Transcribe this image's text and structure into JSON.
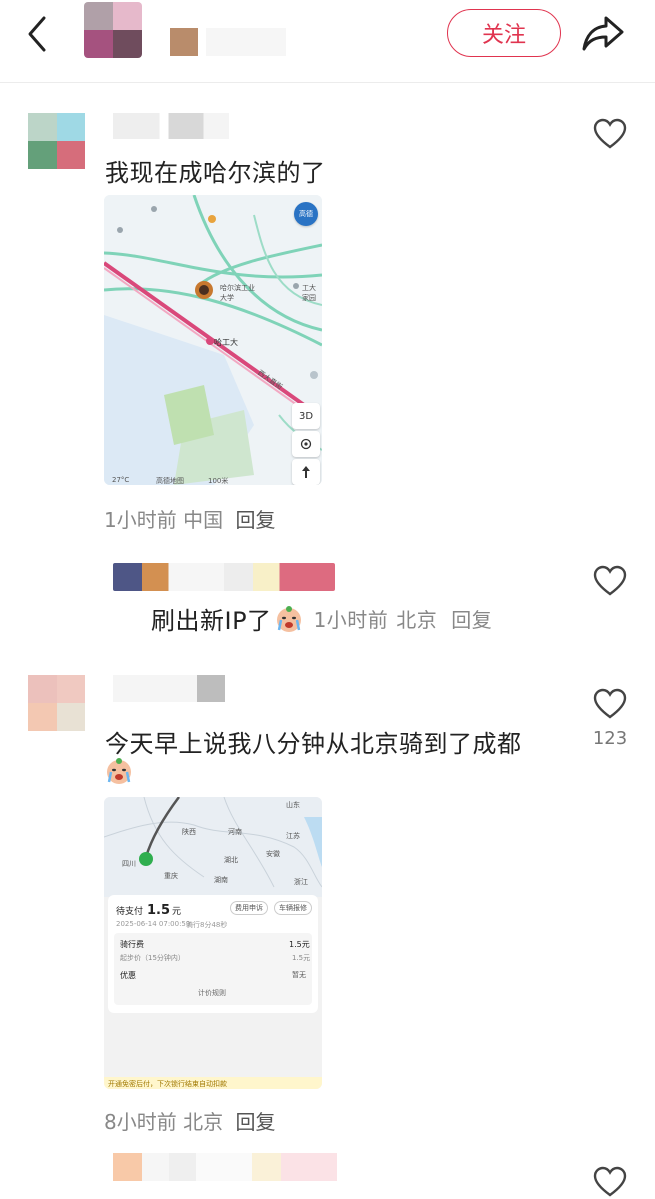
{
  "header": {
    "follow_label": "关注",
    "back_icon": "chevron-left-icon",
    "share_icon": "share-arrow-icon"
  },
  "colors": {
    "accent": "#e0344f",
    "meta": "#888888"
  },
  "comments": [
    {
      "text": "我现在成哈尔滨的了",
      "meta_time": "1小时前",
      "meta_location": "中国",
      "reply_label": "回复",
      "map": {
        "station": "哈工大",
        "road": "西大直街",
        "poi_1": "工大家园",
        "poi_2": "哈尔滨工业大学",
        "temp": "27°C",
        "provider": "高德地图",
        "scale": "100米",
        "btn_3d": "3D",
        "badge": "高德"
      }
    },
    {
      "text": "刷出新IP了",
      "meta_time": "1小时前",
      "meta_location": "北京",
      "reply_label": "回复"
    },
    {
      "text": "今天早上说我八分钟从北京骑到了成都",
      "like_count": "123",
      "meta_time": "8小时前",
      "meta_location": "北京",
      "reply_label": "回复",
      "receipt": {
        "provinces": [
          "山东",
          "陕西",
          "河南",
          "江苏",
          "四川",
          "湖北",
          "安徽",
          "重庆",
          "湖南",
          "浙江"
        ],
        "pay_label": "待支付",
        "amount": "1.5",
        "unit": "元",
        "btn_appeal": "费用申诉",
        "btn_fault": "车辆报修",
        "datetime": "2025-06-14 07:00:59",
        "duration": "骑行8分48秒",
        "fee_label": "骑行费",
        "fee_value": "1.5元",
        "start_label": "起步价（15分钟内）",
        "start_value": "1.5元",
        "discount_label": "优惠",
        "discount_value": "暂无",
        "rules_label": "计价规则",
        "footer_note": "开通免密后付，下次锁行结束自动扣款"
      }
    }
  ]
}
